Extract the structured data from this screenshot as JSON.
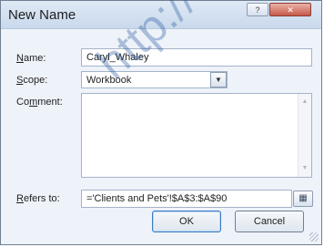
{
  "window": {
    "title": "New Name",
    "help_symbol": "?",
    "close_symbol": "✕"
  },
  "form": {
    "name_label_mnemonic": "N",
    "name_label_rest": "ame:",
    "name_value": "Caryl_Whaley",
    "scope_label_mnemonic": "S",
    "scope_label_rest": "cope:",
    "scope_value": "Workbook",
    "comment_label_pre": "Co",
    "comment_label_mnemonic": "m",
    "comment_label_rest": "ment:",
    "comment_value": "",
    "refers_label_mnemonic": "R",
    "refers_label_rest": "efers to:",
    "refers_value": "='Clients and Pets'!$A$3:$A$90"
  },
  "buttons": {
    "ok": "OK",
    "cancel": "Cancel"
  },
  "watermark": "http://w"
}
